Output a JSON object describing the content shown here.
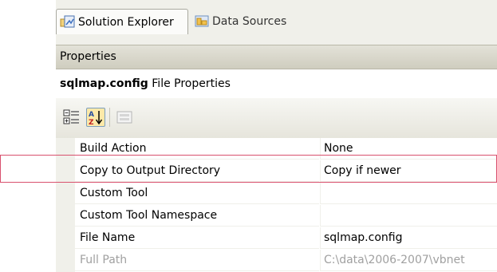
{
  "tabs": [
    {
      "label": "Solution Explorer",
      "icon": "solution-explorer-icon",
      "active": true
    },
    {
      "label": "Data Sources",
      "icon": "data-sources-icon",
      "active": false
    }
  ],
  "properties_title": "Properties",
  "object": {
    "name": "sqlmap.config",
    "type": "File Properties"
  },
  "toolbar": {
    "categorized_icon": "categorized-icon",
    "alphabetical_icon": "alphabetical-sort-icon",
    "property_pages_icon": "property-pages-icon"
  },
  "properties": [
    {
      "name": "Build Action",
      "value": "None"
    },
    {
      "name": "Copy to Output Directory",
      "value": "Copy if newer"
    },
    {
      "name": "Custom Tool",
      "value": ""
    },
    {
      "name": "Custom Tool Namespace",
      "value": ""
    },
    {
      "name": "File Name",
      "value": "sqlmap.config"
    },
    {
      "name": "Full Path",
      "value": "C:\\data\\2006-2007\\vbnet"
    }
  ],
  "colors": {
    "highlight": "#d9516e",
    "selected_button": "#fde9a8"
  }
}
